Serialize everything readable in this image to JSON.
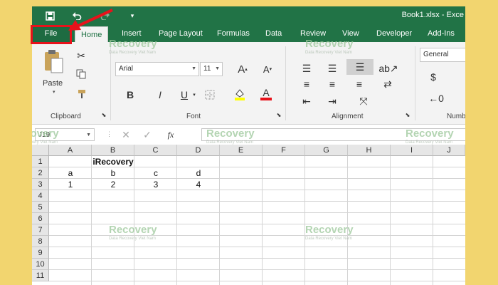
{
  "window": {
    "title": "Book1.xlsx - Exce"
  },
  "quick_access": {
    "save_icon": "save-icon",
    "undo_icon": "undo-icon",
    "redo_icon": "redo-icon",
    "customize_icon": "customize-qat-icon"
  },
  "tabs": [
    {
      "label": "File"
    },
    {
      "label": "Home"
    },
    {
      "label": "Insert"
    },
    {
      "label": "Page Layout"
    },
    {
      "label": "Formulas"
    },
    {
      "label": "Data"
    },
    {
      "label": "Review"
    },
    {
      "label": "View"
    },
    {
      "label": "Developer"
    },
    {
      "label": "Add-Ins"
    }
  ],
  "ribbon": {
    "clipboard": {
      "paste_label": "Paste",
      "group_label": "Clipboard"
    },
    "font": {
      "font_name": "Arial",
      "font_size": "11",
      "group_label": "Font",
      "bold": "B",
      "italic": "I",
      "underline": "U",
      "text_color_glyph": "A"
    },
    "alignment": {
      "group_label": "Alignment"
    },
    "number": {
      "format": "General",
      "group_label": "Numb"
    }
  },
  "formula_bar": {
    "name_box": "J19",
    "fx": "fx",
    "formula": ""
  },
  "sheet": {
    "columns": [
      "A",
      "B",
      "C",
      "D",
      "E",
      "F",
      "G",
      "H",
      "I",
      "J"
    ],
    "rows": [
      "1",
      "2",
      "3",
      "4",
      "5",
      "6",
      "7",
      "8",
      "9",
      "10",
      "11"
    ],
    "cells": {
      "B1": "iRecovery",
      "A2": "a",
      "B2": "b",
      "C2": "c",
      "D2": "d",
      "A3": "1",
      "B3": "2",
      "C3": "3",
      "D3": "4"
    }
  },
  "watermark": {
    "brand": "Recovery",
    "tagline": "Data Recovery Viet Nam"
  },
  "colors": {
    "excel_green": "#217346",
    "highlight_red": "#e8121b",
    "background": "#f2d56f"
  }
}
